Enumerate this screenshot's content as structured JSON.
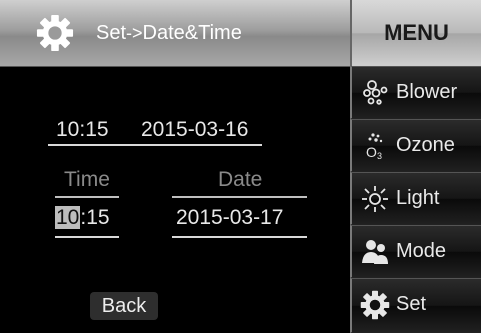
{
  "header": {
    "title_main": "Set",
    "title_sep": "->",
    "title_sub": "Date&Time"
  },
  "menu": {
    "title": "MENU",
    "items": [
      {
        "label": "Blower",
        "icon": "blower-icon"
      },
      {
        "label": "Ozone",
        "icon": "ozone-icon"
      },
      {
        "label": "Light",
        "icon": "light-icon"
      },
      {
        "label": "Mode",
        "icon": "mode-icon"
      },
      {
        "label": "Set",
        "icon": "gear-icon"
      }
    ]
  },
  "current": {
    "time": "10:15",
    "date": "2015-03-16"
  },
  "edit": {
    "time_label": "Time",
    "date_label": "Date",
    "time_cursor_digits": "10",
    "time_rest": ":15",
    "date_value": "2015-03-17"
  },
  "back_label": "Back",
  "colors": {
    "header_gray": "#9e9e9e",
    "cursor_highlight": "#bdbdbd",
    "background": "#000000"
  }
}
